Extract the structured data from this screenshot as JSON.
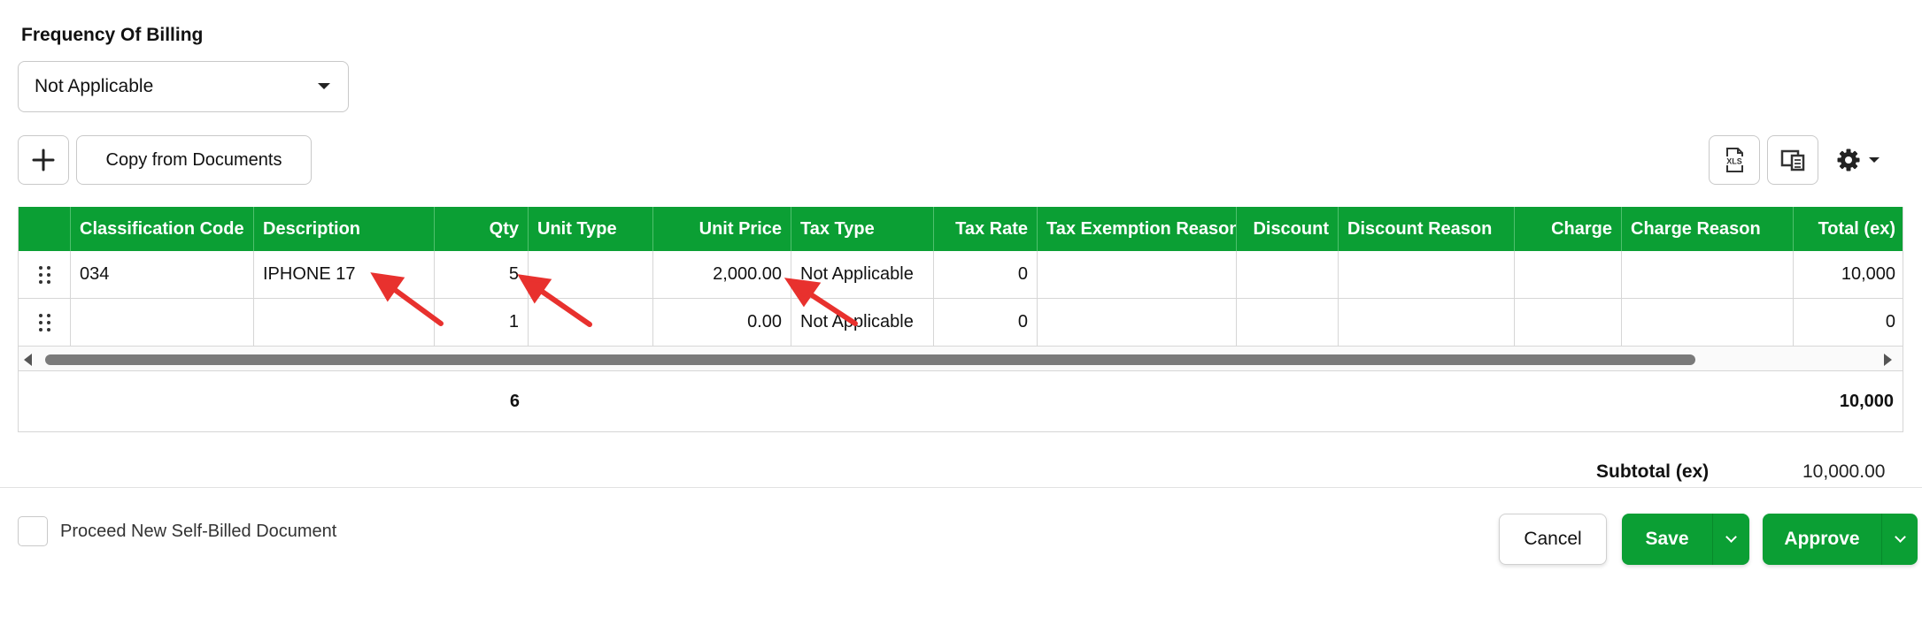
{
  "frequency": {
    "label": "Frequency Of Billing",
    "selected": "Not Applicable"
  },
  "toolbar": {
    "add_icon": "plus-icon",
    "copy_label": "Copy from Documents",
    "export_icon": "xls-file-icon",
    "export_icon_text": "XLS",
    "view_icon": "split-view-icon",
    "settings_icon": "gear-icon"
  },
  "table": {
    "headers": {
      "classification_code": "Classification Code",
      "description": "Description",
      "qty": "Qty",
      "unit_type": "Unit Type",
      "unit_price": "Unit Price",
      "tax_type": "Tax Type",
      "tax_rate": "Tax Rate",
      "tax_exemption_reason": "Tax Exemption Reason",
      "discount": "Discount",
      "discount_reason": "Discount Reason",
      "charge": "Charge",
      "charge_reason": "Charge Reason",
      "total_ex": "Total (ex)"
    },
    "rows": [
      {
        "classification_code": "034",
        "description": "IPHONE 17",
        "qty": "5",
        "unit_type": "",
        "unit_price": "2,000.00",
        "tax_type": "Not Applicable",
        "tax_rate": "0",
        "tax_exemption_reason": "",
        "discount": "",
        "discount_reason": "",
        "charge": "",
        "charge_reason": "",
        "total_ex": "10,000"
      },
      {
        "classification_code": "",
        "description": "",
        "qty": "1",
        "unit_type": "",
        "unit_price": "0.00",
        "tax_type": "Not Applicable",
        "tax_rate": "0",
        "tax_exemption_reason": "",
        "discount": "",
        "discount_reason": "",
        "charge": "",
        "charge_reason": "",
        "total_ex": "0"
      }
    ],
    "footer": {
      "qty_total": "6",
      "total_ex": "10,000"
    }
  },
  "summary": {
    "subtotal_label": "Subtotal (ex)",
    "subtotal_value": "10,000.00"
  },
  "proceed": {
    "label": "Proceed New Self-Billed Document",
    "checked": false
  },
  "actions": {
    "cancel_label": "Cancel",
    "save_label": "Save",
    "approve_label": "Approve"
  },
  "colors": {
    "header_green": "#0b9f34",
    "annotation_red": "#e8312e"
  }
}
